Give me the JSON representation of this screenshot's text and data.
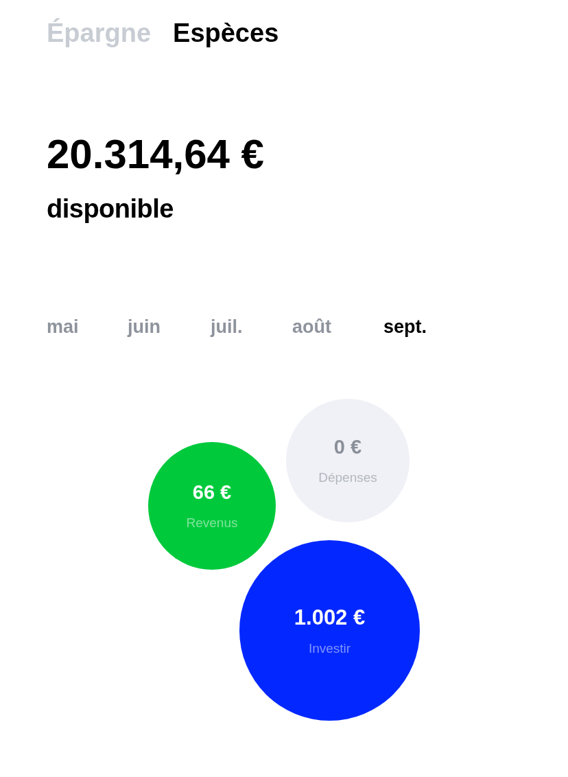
{
  "tabs": [
    {
      "label": "Épargne",
      "selected": false
    },
    {
      "label": "Espèces",
      "selected": true
    }
  ],
  "balance": {
    "amount": "20.314,64 €",
    "caption": "disponible"
  },
  "months": [
    {
      "label": "mai",
      "selected": false
    },
    {
      "label": "juin",
      "selected": false
    },
    {
      "label": "juil.",
      "selected": false
    },
    {
      "label": "août",
      "selected": false
    },
    {
      "label": "sept.",
      "selected": true
    }
  ],
  "bubbles": [
    {
      "amount": "66 €",
      "label": "Revenus",
      "color": "#00c93c"
    },
    {
      "amount": "0 €",
      "label": "Dépenses",
      "color": "#f0f1f6"
    },
    {
      "amount": "1.002 €",
      "label": "Investir",
      "color": "#0328ff"
    }
  ]
}
